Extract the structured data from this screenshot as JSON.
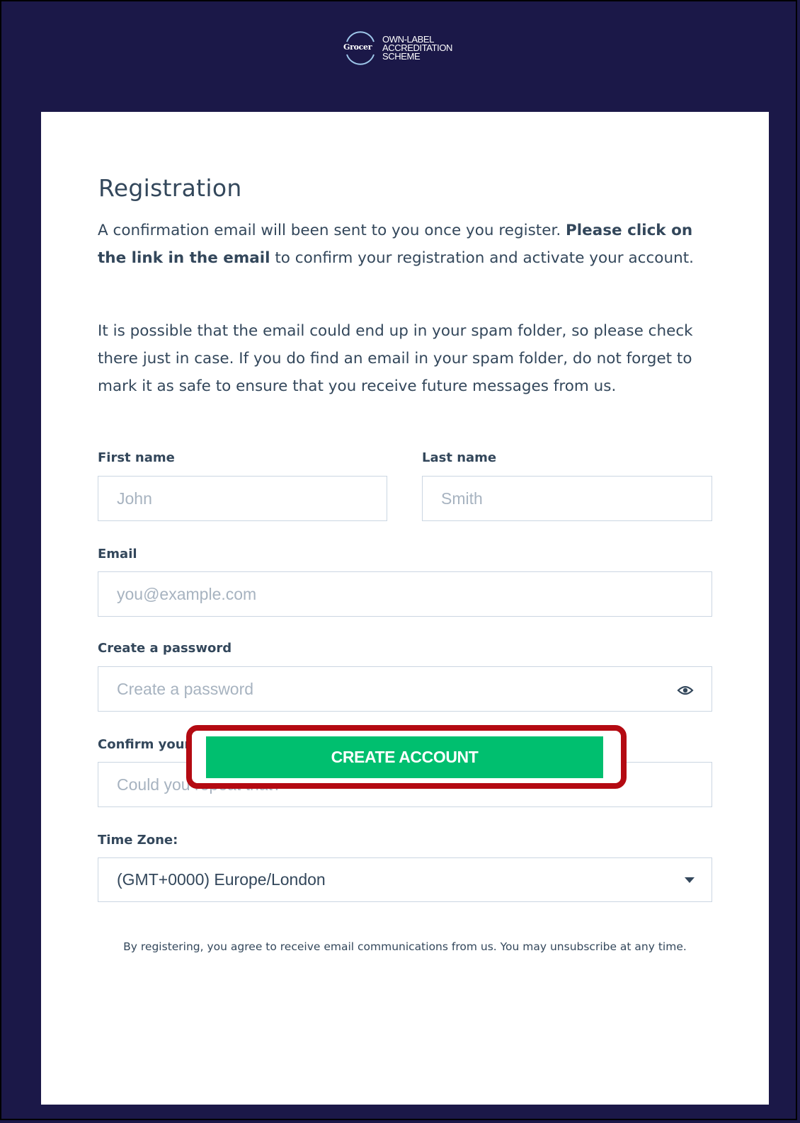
{
  "header": {
    "logo_brand": "Grocer",
    "logo_line1": "OWN-LABEL",
    "logo_line2": "ACCREDITATION",
    "logo_line3": "SCHEME"
  },
  "form": {
    "title": "Registration",
    "intro_part1": "A confirmation email will been sent to you once you register. ",
    "intro_bold": "Please click on the link in the email",
    "intro_part2": " to confirm your registration and activate your account.",
    "spam_note": "It is possible that the email could end up in your spam folder, so please check there just in case. If you do find an email in your spam folder, do not forget to mark it as safe to ensure that you receive future messages from us.",
    "first_name": {
      "label": "First name",
      "placeholder": "John",
      "value": ""
    },
    "last_name": {
      "label": "Last name",
      "placeholder": "Smith",
      "value": ""
    },
    "email": {
      "label": "Email",
      "placeholder": "you@example.com",
      "value": ""
    },
    "password": {
      "label": "Create a password",
      "placeholder": "Create a password",
      "value": "",
      "toggle_icon": "eye-icon"
    },
    "confirm_password": {
      "label": "Confirm your password",
      "placeholder": "Could you repeat that?",
      "value": ""
    },
    "time_zone": {
      "label": "Time Zone:",
      "selected": "(GMT+0000) Europe/London"
    },
    "legal": "By registering, you agree to receive email communications from us. You may unsubscribe at any time.",
    "submit_label": "CREATE ACCOUNT"
  },
  "colors": {
    "page_background": "#1b1848",
    "button_green": "#00bf6f",
    "highlight_red": "#b40a12",
    "text": "#33475b"
  }
}
